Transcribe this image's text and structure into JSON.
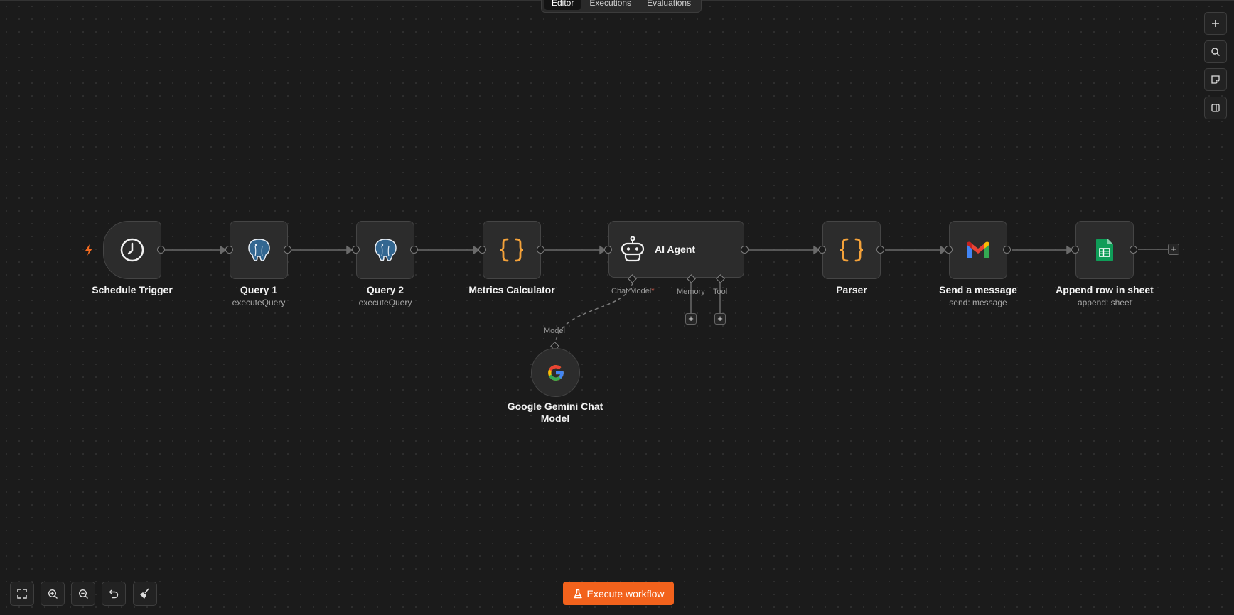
{
  "view_tabs": [
    "Editor",
    "Executions",
    "Evaluations"
  ],
  "nodes": {
    "schedule_trigger": {
      "title": "Schedule Trigger",
      "icon": "clock-icon"
    },
    "query1": {
      "title": "Query 1",
      "subtitle": "executeQuery",
      "icon": "postgres-icon"
    },
    "query2": {
      "title": "Query 2",
      "subtitle": "executeQuery",
      "icon": "postgres-icon"
    },
    "metrics": {
      "title": "Metrics Calculator",
      "icon": "code-braces-icon"
    },
    "ai_agent": {
      "title": "AI Agent",
      "icon": "robot-icon",
      "slots": {
        "chat_model": "Chat Model",
        "required_mark": "*",
        "memory": "Memory",
        "tool": "Tool"
      }
    },
    "parser": {
      "title": "Parser",
      "icon": "code-braces-icon"
    },
    "gmail": {
      "title": "Send a message",
      "subtitle": "send: message",
      "icon": "gmail-icon"
    },
    "sheets": {
      "title": "Append row in sheet",
      "subtitle": "append: sheet",
      "icon": "google-sheets-icon"
    },
    "gemini": {
      "title_line1": "Google Gemini Chat",
      "title_line2": "Model",
      "port_label": "Model",
      "icon": "google-icon"
    }
  },
  "execute_button": {
    "label": "Execute workflow",
    "icon": "flask-icon"
  },
  "colors": {
    "accent": "#f2621c",
    "braces": "#f4a23a",
    "canvas": "#1b1b1b"
  }
}
